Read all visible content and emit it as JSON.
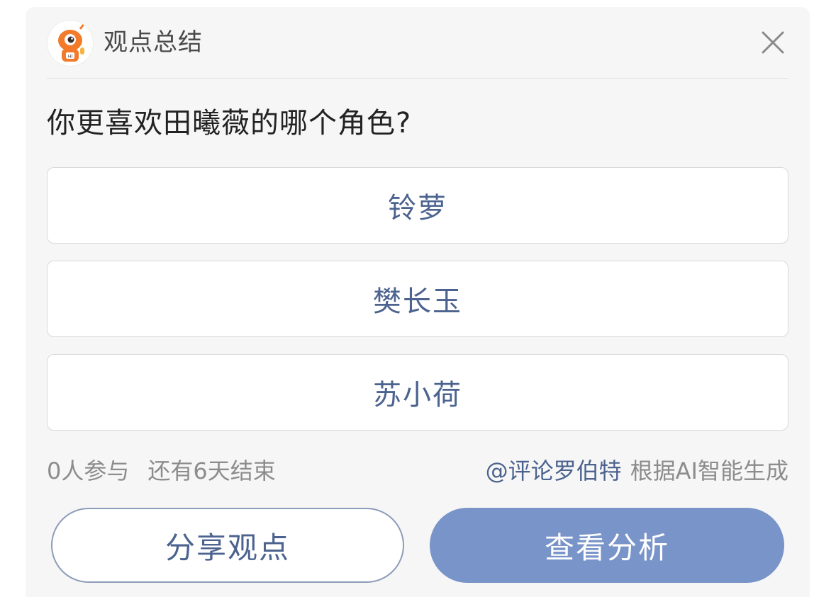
{
  "header": {
    "title": "观点总结",
    "avatar_icon": "robot-mascot-icon",
    "close_icon": "close-icon"
  },
  "question": "你更喜欢田曦薇的哪个角色?",
  "options": [
    {
      "label": "铃萝"
    },
    {
      "label": "樊长玉"
    },
    {
      "label": "苏小荷"
    }
  ],
  "meta": {
    "participants": "0人参与",
    "remaining": "还有6天结束",
    "mention": "@评论罗伯特",
    "generated_note": "根据AI智能生成"
  },
  "actions": {
    "share_label": "分享观点",
    "analysis_label": "查看分析"
  },
  "colors": {
    "accent": "#4c638f",
    "primary_button": "#7994c9",
    "card_background": "#f6f6f6",
    "mascot_orange": "#f27a2a"
  }
}
